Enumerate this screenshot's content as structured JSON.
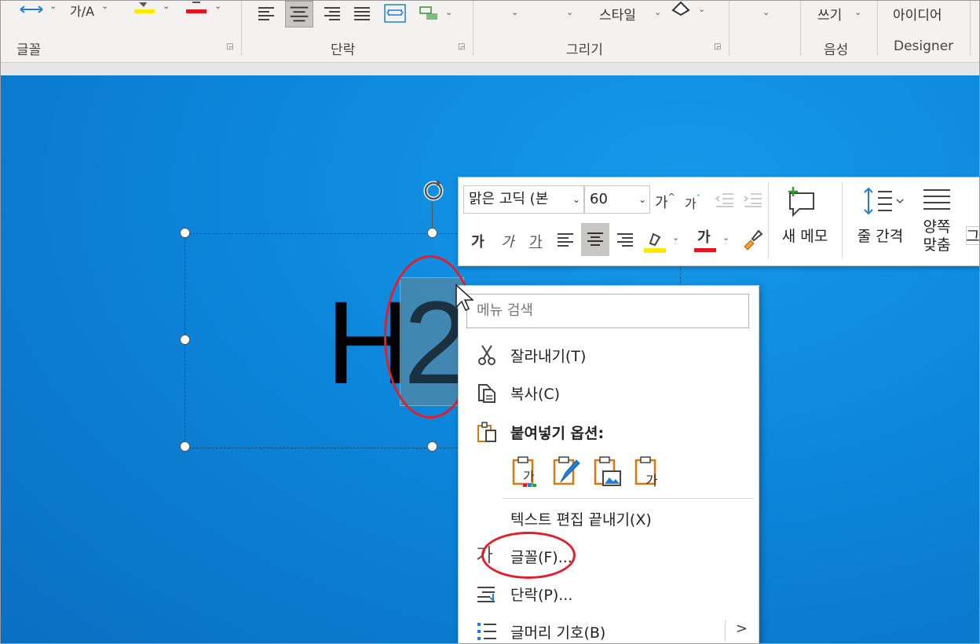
{
  "ribbon": {
    "groups": [
      {
        "label": "글꼴"
      },
      {
        "label": "단락"
      },
      {
        "label": "그리기"
      },
      {
        "label": "음성"
      },
      {
        "label": "Designer"
      }
    ],
    "draw_style_label": "스타일",
    "voice_dictate_label": "쓰기",
    "designer_ideas_label": "아이디어",
    "font_color": "#e8141c",
    "highlight_color": "#ffe800"
  },
  "slide": {
    "text_normal": "H",
    "text_selected": "2"
  },
  "mini_toolbar": {
    "font_name": "맑은 고딕 (본",
    "font_size": "60",
    "grow_font_glyph": "가",
    "shrink_font_glyph": "가",
    "bold_glyph": "가",
    "italic_glyph": "가",
    "underline_glyph": "가",
    "font_color_glyph": "가",
    "new_comment_label": "새 메모",
    "line_spacing_label": "줄 간격",
    "justify_label_line1": "양쪽",
    "justify_label_line2": "맞춤",
    "cut_off_label": "그"
  },
  "context_menu": {
    "search_placeholder": "메뉴 검색",
    "items": [
      {
        "label": "잘라내기(T)",
        "icon": "scissors-icon"
      },
      {
        "label": "복사(C)",
        "icon": "copy-icon"
      },
      {
        "label": "붙여넣기 옵션:",
        "icon": "paste-icon"
      },
      {
        "label": "텍스트 편집 끝내기(X)",
        "icon": ""
      },
      {
        "label": "글꼴(F)...",
        "icon": "font-icon"
      },
      {
        "label": "단락(P)...",
        "icon": "paragraph-icon"
      },
      {
        "label": "글머리 기호(B)",
        "icon": "bullets-icon"
      }
    ],
    "paste_options": [
      {
        "icon": "paste-use-destination-theme-icon",
        "glyph": "가"
      },
      {
        "icon": "paste-keep-source-formatting-icon",
        "glyph": ""
      },
      {
        "icon": "paste-picture-icon",
        "glyph": ""
      },
      {
        "icon": "paste-keep-text-only-icon",
        "glyph": "가"
      }
    ],
    "font_icon_glyph": "가"
  },
  "annotations": {
    "highlight_color": "#e0202a"
  }
}
